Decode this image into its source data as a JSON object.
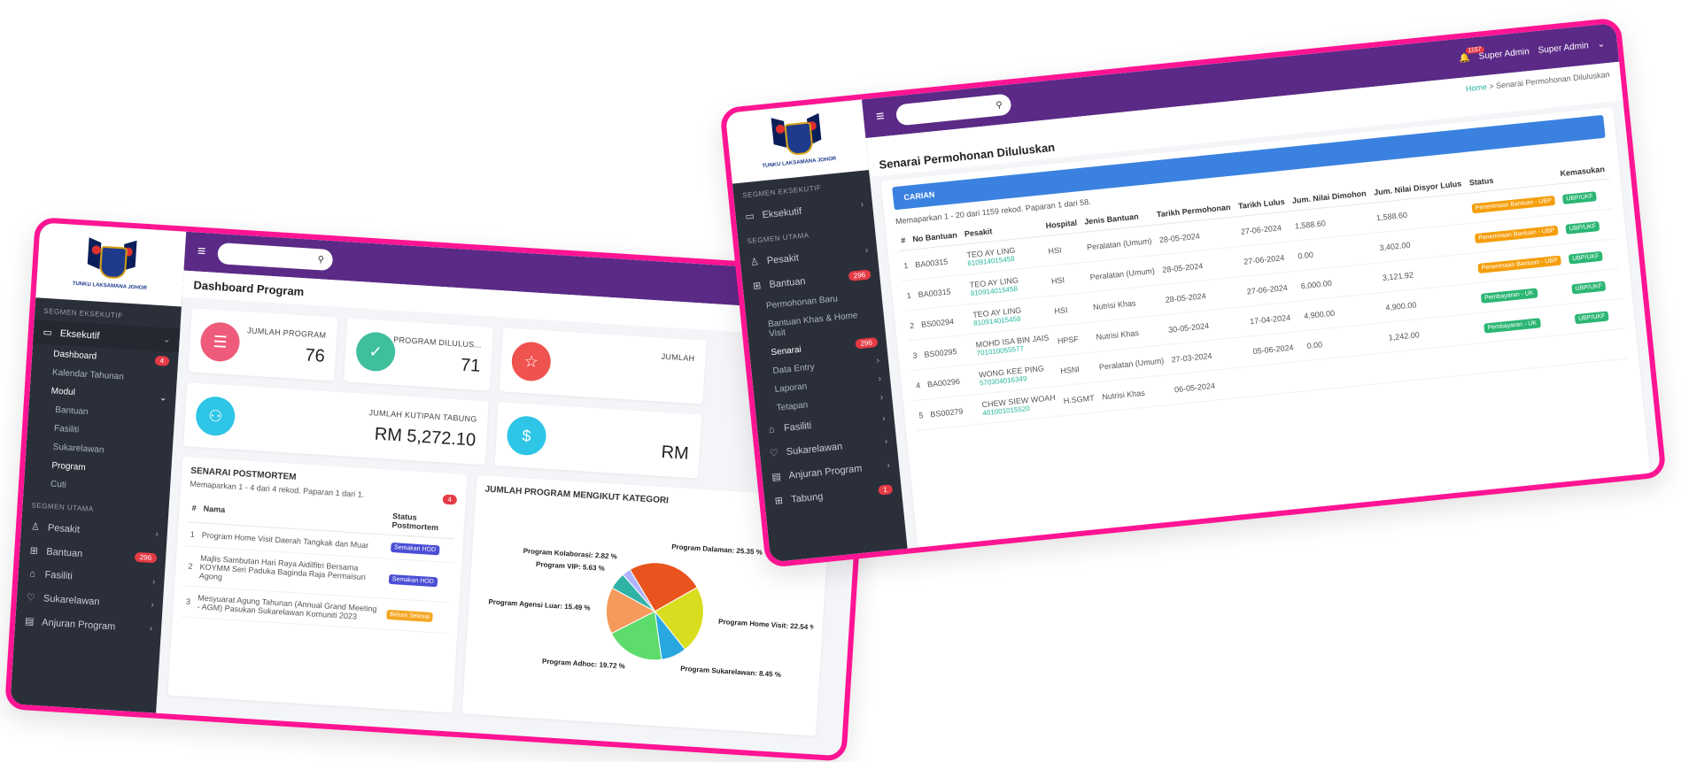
{
  "win1": {
    "logo_text": "TUNKU LAKSAMANA JOHOR",
    "segments": {
      "eksekutif": "SEGMEN EKSEKUTIF",
      "utama": "SEGMEN UTAMA"
    },
    "nav": {
      "eksekutif": "Eksekutif",
      "dashboard": "Dashboard",
      "dashboard_badge": "4",
      "kalendar": "Kalendar Tahunan",
      "modul": "Modul",
      "bantuan_sub": "Bantuan",
      "fasiliti_sub": "Fasiliti",
      "sukarelawan_sub": "Sukarelawan",
      "program_sub": "Program",
      "cuti_sub": "Cuti",
      "pesakit": "Pesakit",
      "bantuan": "Bantuan",
      "bantuan_badge": "296",
      "fasiliti": "Fasiliti",
      "sukarelawan": "Sukarelawan",
      "anjuran": "Anjuran Program"
    },
    "page_title": "Dashboard Program",
    "stats": [
      {
        "label": "JUMLAH PROGRAM",
        "value": "76",
        "color": "#ee5b7b",
        "icon": "list-check-icon"
      },
      {
        "label": "PROGRAM DILULUS...",
        "value": "71",
        "color": "#3fbf9c",
        "icon": "shield-check-icon"
      },
      {
        "label": "JUMLAH",
        "value": "",
        "color": "#ef5350",
        "icon": "star-icon"
      },
      {
        "label": "JUMLAH KUTIPAN TABUNG",
        "value": "RM 5,272.10",
        "color": "#2ec5e6",
        "icon": "user-donate-icon"
      },
      {
        "label": "",
        "value": "RM",
        "color": "#2ec5e6",
        "icon": "dollar-icon"
      }
    ],
    "postmortem": {
      "title": "SENARAI POSTMORTEM",
      "summary": "Memaparkan 1 - 4 dari 4 rekod. Paparan 1 dari 1.",
      "badge": "4",
      "headers": [
        "#",
        "Nama",
        "Status Postmortem"
      ],
      "rows": [
        {
          "no": "1",
          "nama": "Program Home Visit Daerah Tangkak dan Muar",
          "status": "Semakan HOD",
          "status_color": "#4b4fd6"
        },
        {
          "no": "2",
          "nama": "Majlis Sambutan Hari Raya Aidilfitri Bersama KOYMM Seri Paduka Baginda Raja Permaisuri Agong",
          "status": "Semakan HOD",
          "status_color": "#4b4fd6"
        },
        {
          "no": "3",
          "nama": "Mesyuarat Agung Tahunan (Annual Grand Meeting - AGM) Pasukan Sukarelawan Komuniti 2023",
          "status": "Belum Selesai",
          "status_color": "#f5a623"
        }
      ]
    },
    "chart_title": "JUMLAH PROGRAM MENGIKUT KATEGORI"
  },
  "chart_data": {
    "type": "pie",
    "title": "JUMLAH PROGRAM MENGIKUT KATEGORI",
    "labels": [
      "Program Dalaman: 25.35 %",
      "Program Home Visit: 22.54 %",
      "Program Sukarelawan: 8.45 %",
      "Program Adhoc: 19.72 %",
      "Program Agensi Luar: 15.49 %",
      "Program VIP: 5.63 %",
      "Program Kolaborasi: 2.82 %"
    ],
    "values": [
      25.35,
      22.54,
      8.45,
      19.72,
      15.49,
      5.63,
      2.82
    ],
    "colors": [
      "#e9531d",
      "#d9dd1f",
      "#29a8e0",
      "#5ddc6b",
      "#f59a5c",
      "#2fb3a7",
      "#b0b3ff"
    ]
  },
  "win2": {
    "bell_count": "1157",
    "user_1": "Super Admin",
    "user_2": "Super Admin",
    "breadcrumb_home": "Home",
    "breadcrumb_sep": ">",
    "breadcrumb_page": "Senarai Permohonan Diluluskan",
    "page_title": "Senarai Permohonan Diluluskan",
    "nav": {
      "seg_eksekutif": "SEGMEN EKSEKUTIF",
      "eksekutif": "Eksekutif",
      "seg_utama": "SEGMEN UTAMA",
      "pesakit": "Pesakit",
      "bantuan": "Bantuan",
      "bantuan_badge": "296",
      "permohonan_baru": "Permohonan Baru",
      "bantuan_khas": "Bantuan Khas & Home Visit",
      "senarai": "Senarai",
      "senarai_badge": "296",
      "data_entry": "Data Entry",
      "laporan": "Laporan",
      "tetapan": "Tetapan",
      "fasiliti": "Fasiliti",
      "sukarelawan": "Sukarelawan",
      "anjuran": "Anjuran Program",
      "tabung": "Tabung",
      "tabung_badge": "1"
    },
    "carian": "CARIAN",
    "summary": "Memaparkan 1 - 20 dari 1159 rekod. Paparan 1 dari 58.",
    "headers": [
      "#",
      "No Bantuan",
      "Pesakit",
      "Hospital",
      "Jenis Bantuan",
      "Tarikh Permohonan",
      "Tarikh Lulus",
      "Jum. Nilai Dimohon",
      "Jum. Nilai Disyor Lulus",
      "Status",
      "Kemasukan"
    ],
    "rows": [
      {
        "no": "1",
        "bantuan": "BA00315",
        "nama": "TEO AY LING",
        "ic": "810914015458",
        "hospital": "HSI",
        "jenis": "Peralatan (Umum)",
        "tarikh_mohon": "28-05-2024",
        "tarikh_lulus": "27-06-2024",
        "dimohon": "1,588.60",
        "disyor": "1,588.60",
        "status": "Penerimaan Bantuan - UBP",
        "status_color": "#f59e0b",
        "masuk": "UBP/UKF"
      },
      {
        "no": "1",
        "bantuan": "BA00315",
        "nama": "TEO AY LING",
        "ic": "810914015458",
        "hospital": "HSI",
        "jenis": "Peralatan (Umum)",
        "tarikh_mohon": "28-05-2024",
        "tarikh_lulus": "27-06-2024",
        "dimohon": "0.00",
        "disyor": "3,402.00",
        "status": "Penerimaan Bantuan - UBP",
        "status_color": "#f59e0b",
        "masuk": "UBP/UKF"
      },
      {
        "no": "2",
        "bantuan": "BS00294",
        "nama": "TEO AY LING",
        "ic": "810914015458",
        "hospital": "HSI",
        "jenis": "Nutrisi Khas",
        "tarikh_mohon": "28-05-2024",
        "tarikh_lulus": "27-06-2024",
        "dimohon": "6,000.00",
        "disyor": "3,121.92",
        "status": "Penerimaan Bantuan - UBP",
        "status_color": "#f59e0b",
        "masuk": "UBP/UKF"
      },
      {
        "no": "3",
        "bantuan": "BS00295",
        "nama": "MOHD ISA BIN JAIS",
        "ic": "701010055577",
        "hospital": "HPSF",
        "jenis": "Nutrisi Khas",
        "tarikh_mohon": "30-05-2024",
        "tarikh_lulus": "17-04-2024",
        "dimohon": "4,900.00",
        "disyor": "4,900.00",
        "status": "Pembayaran - UK",
        "status_color": "#2bb673",
        "masuk": "UBP/UKF"
      },
      {
        "no": "4",
        "bantuan": "BA00296",
        "nama": "WONG KEE PING",
        "ic": "570304016349",
        "hospital": "HSNI",
        "jenis": "Peralatan (Umum)",
        "tarikh_mohon": "27-03-2024",
        "tarikh_lulus": "05-06-2024",
        "dimohon": "0.00",
        "disyor": "1,242.00",
        "status": "Pembayaran - UK",
        "status_color": "#2bb673",
        "masuk": "UBP/UKF"
      },
      {
        "no": "5",
        "bantuan": "BS00279",
        "nama": "CHEW SIEW WOAH",
        "ic": "481001015520",
        "hospital": "H.SGMT",
        "jenis": "Nutrisi Khas",
        "tarikh_mohon": "06-05-2024",
        "tarikh_lulus": "",
        "dimohon": "",
        "disyor": "",
        "status": "",
        "status_color": "#2bb673",
        "masuk": ""
      }
    ]
  }
}
